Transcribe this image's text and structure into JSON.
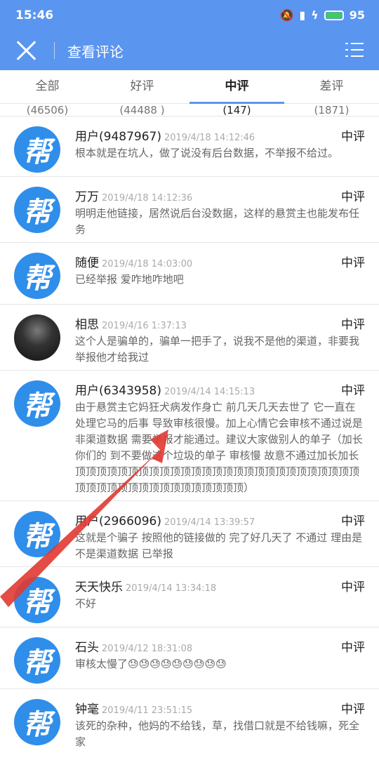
{
  "status": {
    "time": "15:46",
    "battery": "95",
    "battery_color": "#3bd14a"
  },
  "appbar": {
    "title": "查看评论",
    "close_icon": "close-icon",
    "menu_icon": "list-menu-icon",
    "accent": "#5a95f0"
  },
  "tabs": [
    {
      "label": "全部",
      "count": "(46506)"
    },
    {
      "label": "好评",
      "count": "(44488 )"
    },
    {
      "label": "中评",
      "count": "(147)"
    },
    {
      "label": "差评",
      "count": "(1871)"
    }
  ],
  "active_tab": "中评",
  "avatar_glyph": "帮",
  "comments": [
    {
      "name": "用户(9487967)",
      "date": "2019/4/18 14:12:46",
      "rating": "中评",
      "text": "根本就是在坑人，做了说没有后台数据，不举报不给过。"
    },
    {
      "name": "万万",
      "date": "2019/4/18 14:12:36",
      "rating": "中评",
      "text": "明明走他链接，居然说后台没数据，这样的悬赏主也能发布任务"
    },
    {
      "name": "随便",
      "date": "2019/4/18 14:03:00",
      "rating": "中评",
      "text": "已经举报 爱咋地咋地吧"
    },
    {
      "name": "相思",
      "date": "2019/4/16 1:37:13",
      "rating": "中评",
      "text": "这个人是骗单的，骗单一把手了，说我不是他的渠道，非要我举报他才给我过"
    },
    {
      "name": "用户(6343958)",
      "date": "2019/4/14 14:15:13",
      "rating": "中评",
      "text": "由于悬赏主它妈狂犬病发作身亡 前几天几天去世了 它一直在处理它马的后事 导致审核很慢。加上心情它会审核不通过说是非渠道数据 需要举报才能通过。建议大家做别人的单子（加长你们的 到不要做这个垃圾的单子 审核慢 故意不通过加长加长顶顶顶顶顶顶顶顶顶顶顶顶顶顶顶顶顶顶顶顶顶顶顶顶顶顶顶顶顶顶顶顶顶顶顶顶顶顶顶顶顶顶顶）"
    },
    {
      "name": "用户(2966096)",
      "date": "2019/4/14 13:39:57",
      "rating": "中评",
      "text": "这就是个骗子 按照他的链接做的 完了好几天了 不通过 理由是不是渠道数据 已举报"
    },
    {
      "name": "天天快乐",
      "date": "2019/4/14 13:34:18",
      "rating": "中评",
      "text": "不好"
    },
    {
      "name": "石头",
      "date": "2019/4/12 18:31:08",
      "rating": "中评",
      "text": "审核太慢了😓😓😓😓😓😓😓😓😓"
    },
    {
      "name": "钟毫",
      "date": "2019/4/11 23:51:15",
      "rating": "中评",
      "text": "该死的杂种，他妈的不给钱，草，找借口就是不给钱嘛，死全家"
    }
  ]
}
